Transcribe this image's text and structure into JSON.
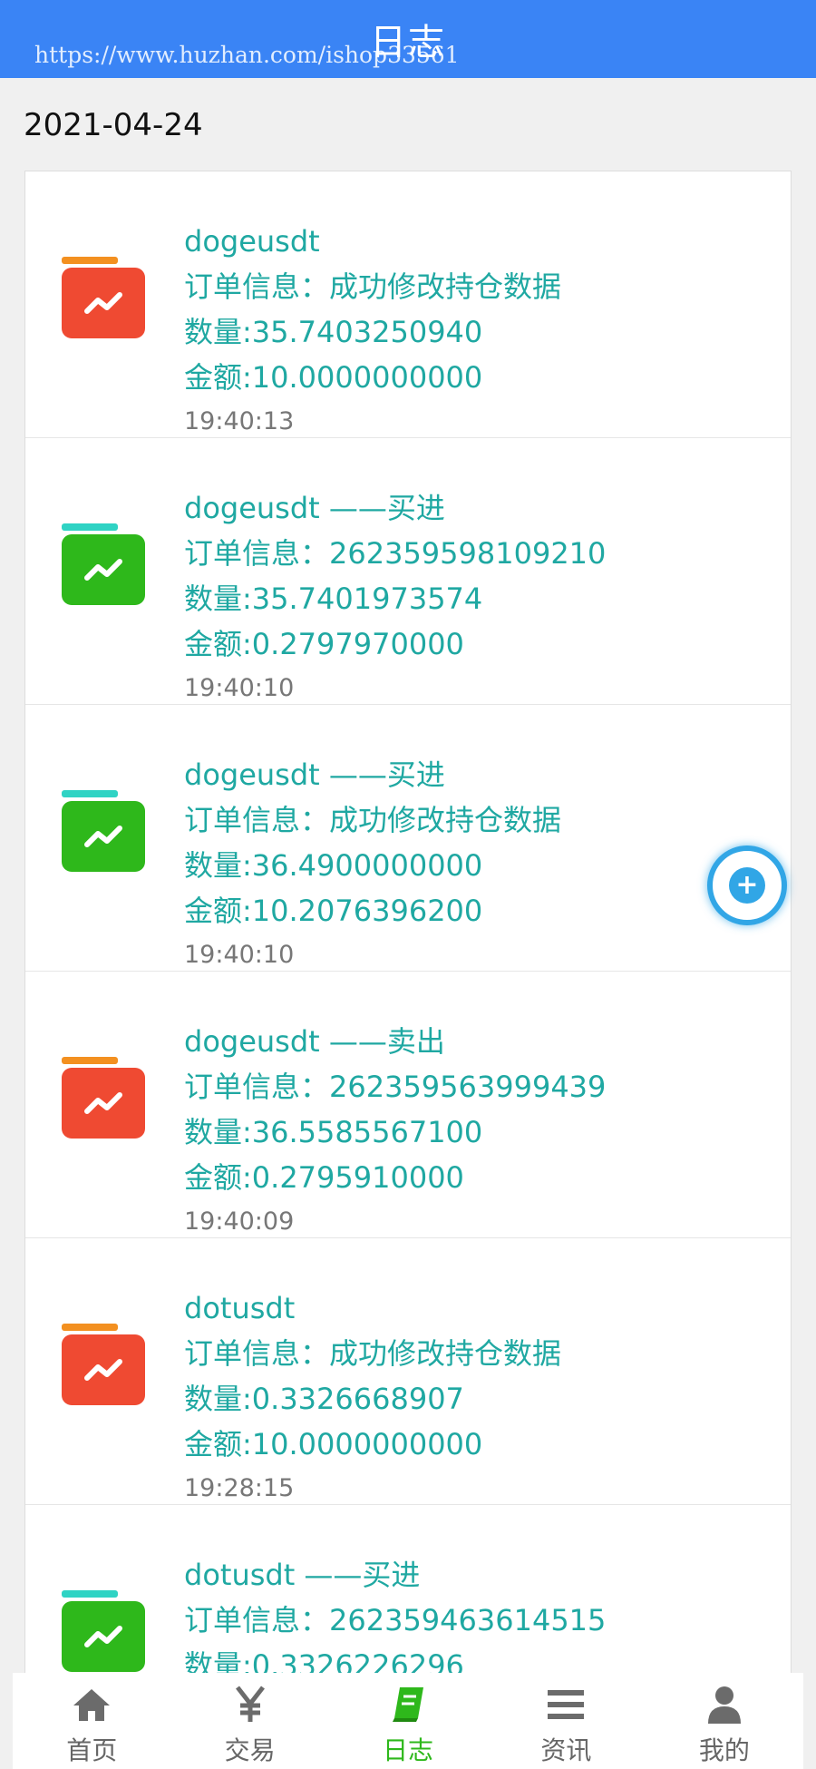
{
  "header": {
    "title": "日志",
    "watermark": "https://www.huzhan.com/ishop33561"
  },
  "date": "2021-04-24",
  "colors": {
    "header_bg": "#3a84f5",
    "text_teal": "#1fa8a2",
    "buy_green": "#2eb81b",
    "sell_red": "#ef4a32",
    "fab_blue": "#31a6e6"
  },
  "entries": [
    {
      "kind": "sell",
      "icon": "chart-red-folder-icon",
      "symbol": "dogeusdt",
      "order": "订单信息：成功修改持仓数据",
      "qty": "数量:35.7403250940",
      "amount": "金额:10.0000000000",
      "time": "19:40:13"
    },
    {
      "kind": "buy",
      "icon": "chart-green-folder-icon",
      "symbol": "dogeusdt ——买进",
      "order": "订单信息：262359598109210",
      "qty": "数量:35.7401973574",
      "amount": "金额:0.2797970000",
      "time": "19:40:10"
    },
    {
      "kind": "buy",
      "icon": "chart-green-folder-icon",
      "symbol": "dogeusdt ——买进",
      "order": "订单信息：成功修改持仓数据",
      "qty": "数量:36.4900000000",
      "amount": "金额:10.2076396200",
      "time": "19:40:10"
    },
    {
      "kind": "sell",
      "icon": "chart-red-folder-icon",
      "symbol": "dogeusdt ——卖出",
      "order": "订单信息：262359563999439",
      "qty": "数量:36.5585567100",
      "amount": "金额:0.2795910000",
      "time": "19:40:09"
    },
    {
      "kind": "sell",
      "icon": "chart-red-folder-icon",
      "symbol": "dotusdt",
      "order": "订单信息：成功修改持仓数据",
      "qty": "数量:0.3326668907",
      "amount": "金额:10.0000000000",
      "time": "19:28:15"
    },
    {
      "kind": "buy",
      "icon": "chart-green-folder-icon",
      "symbol": "dotusdt ——买进",
      "order": "订单信息：262359463614515",
      "qty": "数量:0.3326226296",
      "amount": "",
      "time": ""
    }
  ],
  "fab": {
    "icon": "plus-circle-icon",
    "glyph": "+"
  },
  "tabbar": [
    {
      "label": "首页",
      "icon": "home-icon"
    },
    {
      "label": "交易",
      "icon": "yen-icon"
    },
    {
      "label": "日志",
      "icon": "book-icon",
      "active": true
    },
    {
      "label": "资讯",
      "icon": "menu-icon"
    },
    {
      "label": "我的",
      "icon": "user-icon"
    }
  ]
}
